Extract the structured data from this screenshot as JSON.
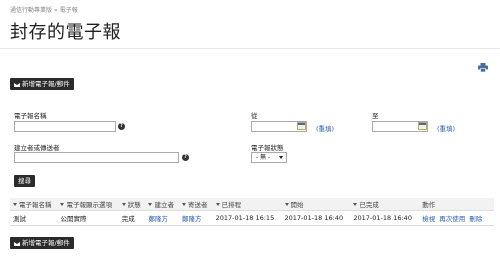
{
  "breadcrumb": {
    "parent": "通信行動專業版",
    "separator": "»",
    "current": "電子報"
  },
  "page_title": "封存的電子報",
  "toolbar": {
    "new_button": "新增電子報/郵件"
  },
  "filters": {
    "name_label": "電子報名稱",
    "name_value": "",
    "creator_label": "建立者或傳送者",
    "creator_value": "",
    "from_label": "從",
    "to_label": "至",
    "reset_label": "(重填)",
    "status_label": "電子報狀態",
    "status_selected": "- 無 -",
    "search_button": "搜尋",
    "help_glyph": "?"
  },
  "table": {
    "columns": [
      "電子報名稱",
      "電子報顯示選項",
      "狀態",
      "建立者",
      "寄送者",
      "已排程",
      "開始",
      "已完成",
      "動作"
    ],
    "rows": [
      {
        "name": "測試",
        "display": "公開實際",
        "status": "完成",
        "creator": "鄭隆方",
        "sender": "鄭隆方",
        "scheduled": "2017-01-18 16:15",
        "start": "2017-01-18 16:40",
        "done": "2017-01-18 16:40",
        "actions": [
          "檢視",
          "再次使用",
          "刪除"
        ]
      }
    ]
  },
  "footer": {
    "new_button": "新增電子報/郵件"
  },
  "icons": {
    "print": "printer-icon",
    "calendar": "calendar-icon",
    "help": "help-icon",
    "mail": "envelope-icon"
  },
  "colors": {
    "link": "#2a5db0",
    "button": "#2b2b2b"
  }
}
